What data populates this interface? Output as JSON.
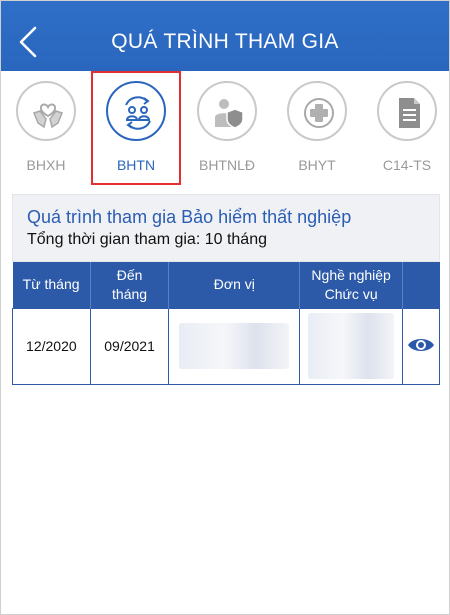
{
  "header": {
    "title": "QUÁ TRÌNH THAM GIA"
  },
  "tabs": [
    {
      "label": "BHXH",
      "icon": "hands-heart-icon",
      "active": false
    },
    {
      "label": "BHTN",
      "icon": "people-exchange-icon",
      "active": true
    },
    {
      "label": "BHTNLĐ",
      "icon": "worker-shield-icon",
      "active": false
    },
    {
      "label": "BHYT",
      "icon": "medical-cross-icon",
      "active": false
    },
    {
      "label": "C14-TS",
      "icon": "document-icon",
      "active": false
    }
  ],
  "card": {
    "title": "Quá trình tham gia Bảo hiểm thất nghiệp",
    "total": "Tổng thời gian tham gia: 10 tháng"
  },
  "table": {
    "headers": {
      "from": "Từ tháng",
      "to_line1": "Đến",
      "to_line2": "tháng",
      "unit": "Đơn vị",
      "job_line1": "Nghề nghiệp",
      "job_line2": "Chức vụ"
    },
    "rows": [
      {
        "from": "12/2020",
        "to": "09/2021"
      }
    ]
  },
  "colors": {
    "primary": "#2a66bd",
    "header_row": "#2c5aa8",
    "highlight_border": "#e03030"
  }
}
